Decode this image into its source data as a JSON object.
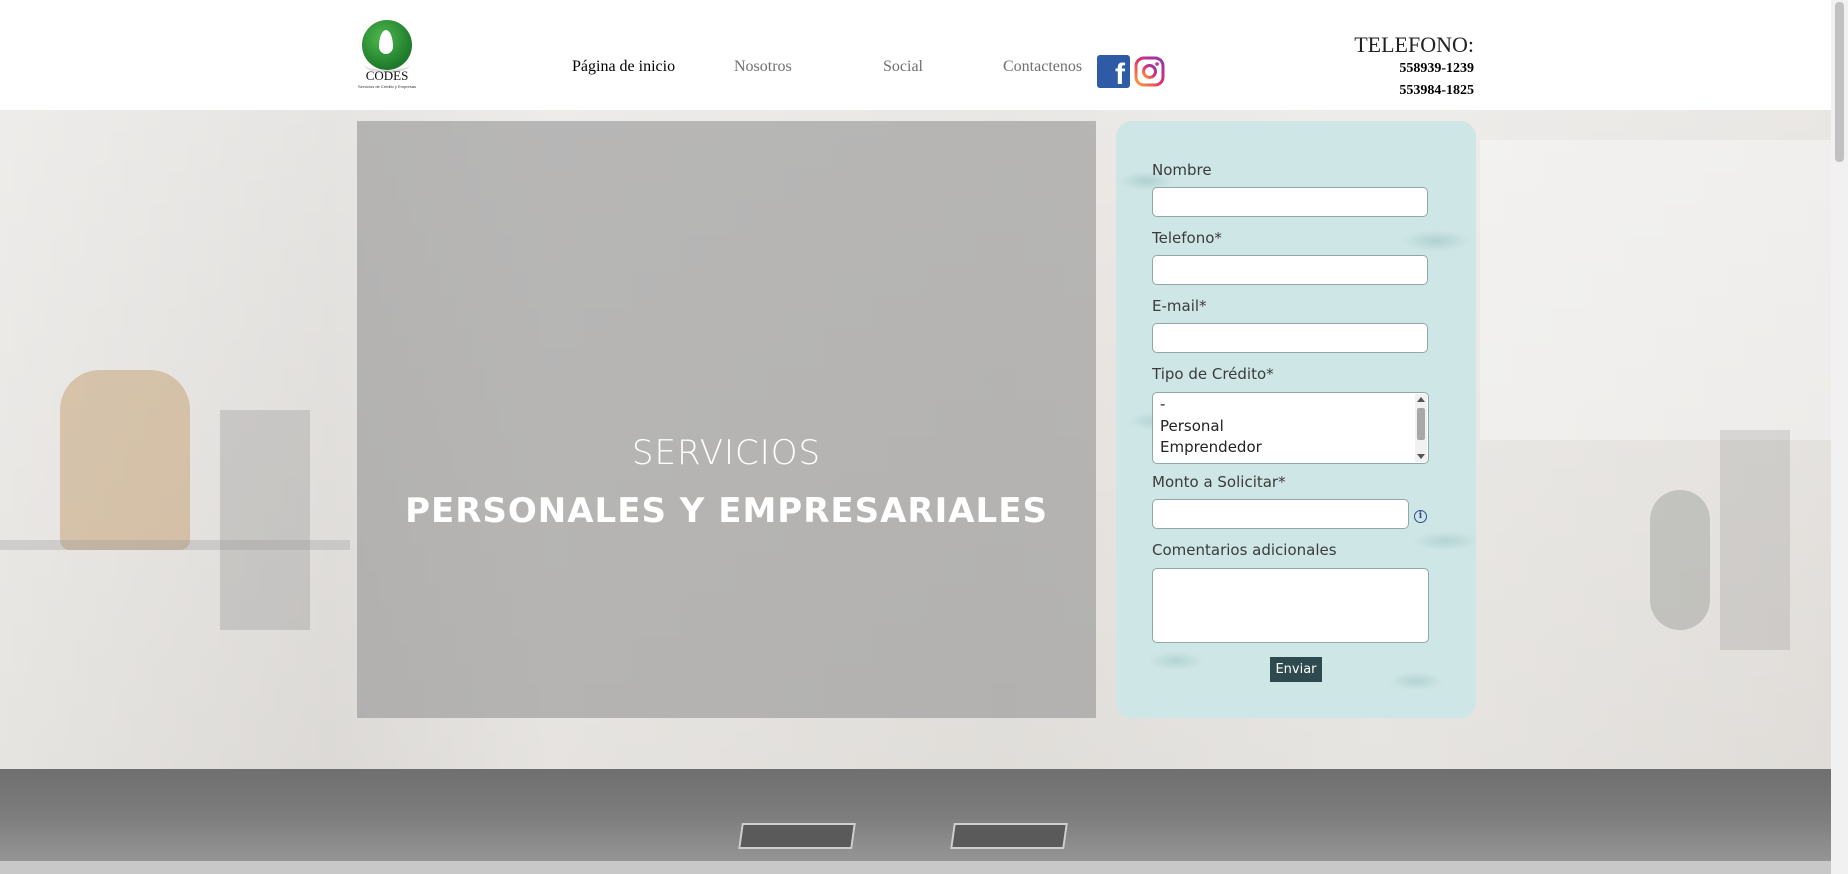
{
  "stray_char": ">",
  "logo": {
    "name": "CODES",
    "tagline": "Servicios de Crédito y Empresas"
  },
  "nav": [
    {
      "label": "Página de inicio",
      "active": true
    },
    {
      "label": "Nosotros",
      "active": false
    },
    {
      "label": "Social",
      "active": false
    },
    {
      "label": "Contactenos",
      "active": false
    }
  ],
  "social": [
    {
      "icon": "facebook-icon",
      "glyph": "f"
    },
    {
      "icon": "instagram-icon"
    }
  ],
  "contact": {
    "title": "TELEFONO:",
    "phones": [
      "558939-1239",
      "553984-1825"
    ]
  },
  "promo": {
    "line1": "SERVICIOS",
    "line2": "PERSONALES Y EMPRESARIALES"
  },
  "form": {
    "name_label": "Nombre",
    "phone_label": "Telefono*",
    "email_label": "E-mail*",
    "credit_label": "Tipo de Crédito*",
    "credit_options": [
      "-",
      "Personal",
      "Emprendedor"
    ],
    "amount_label": "Monto a Solicitar*",
    "info_glyph": "i",
    "comments_label": "Comentarios adicionales",
    "submit_label": "Enviar"
  },
  "colors": {
    "accent": "#2f4a4e",
    "form_bg": "#cfe6e6",
    "facebook": "#2e5aa6"
  }
}
